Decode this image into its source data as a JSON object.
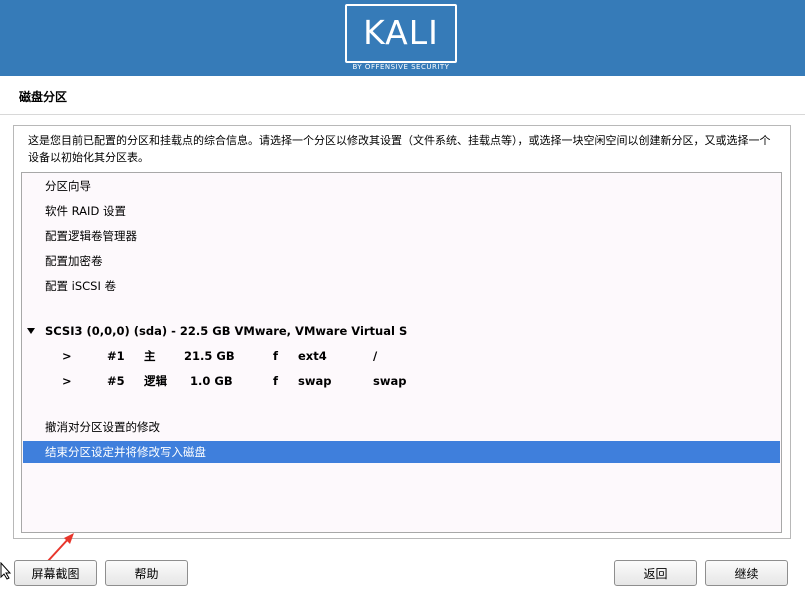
{
  "header": {
    "logo_text": "KALI",
    "logo_subtitle": "BY OFFENSIVE SECURITY",
    "banner_color": "#367bb8"
  },
  "page_title": "磁盘分区",
  "description": "这是您目前已配置的分区和挂载点的综合信息。请选择一个分区以修改其设置（文件系统、挂载点等），或选择一块空闲空间以创建新分区，又或选择一个设备以初始化其分区表。",
  "menu_items": [
    "分区向导",
    "软件 RAID 设置",
    "配置逻辑卷管理器",
    "配置加密卷",
    "配置 iSCSI 卷"
  ],
  "disk": {
    "label": "SCSI3 (0,0,0) (sda) - 22.5 GB VMware, VMware Virtual S",
    "partitions": [
      {
        "marker": ">",
        "number": "#1",
        "type": "主",
        "size": "21.5 GB",
        "flag": "f",
        "fs": "ext4",
        "mount": "/"
      },
      {
        "marker": ">",
        "number": "#5",
        "type": "逻辑",
        "size": "1.0 GB",
        "flag": "f",
        "fs": "swap",
        "mount": "swap"
      }
    ]
  },
  "actions": {
    "undo": "撤消对分区设置的修改",
    "finish": "结束分区设定并将修改写入磁盘"
  },
  "buttons": {
    "screenshot": "屏幕截图",
    "help": "帮助",
    "back": "返回",
    "continue": "继续"
  },
  "colors": {
    "selection": "#3f7fdc",
    "annotation_arrow": "#e8362c"
  }
}
